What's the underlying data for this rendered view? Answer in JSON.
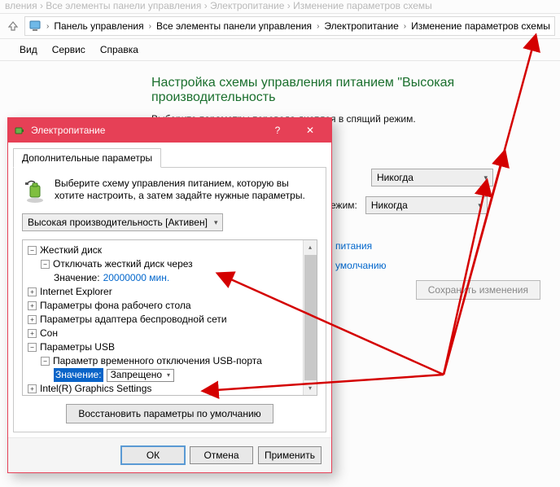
{
  "faded_title_suffix": "вления › Все элементы панели управления › Электропитание › Изменение параметров схемы",
  "breadcrumb": {
    "items": [
      "Панель управления",
      "Все элементы панели управления",
      "Электропитание",
      "Изменение параметров схемы"
    ]
  },
  "menu": {
    "items": [
      "Вид",
      "Сервис",
      "Справка"
    ]
  },
  "page": {
    "headline": "Настройка схемы управления питанием \"Высокая производительность",
    "subtext": "Выберите параметры перевода дисплея в спящий режим.",
    "row_suffix": "ежим:",
    "select1_value": "Никогда",
    "select2_value": "Никогда",
    "link1": "питания",
    "link2": "умолчанию",
    "save_button": "Сохранить изменения"
  },
  "dialog": {
    "title": "Электропитание",
    "tab_label": "Дополнительные параметры",
    "intro_text": "Выберите схему управления питанием, которую вы хотите настроить, а затем задайте нужные параметры.",
    "plan_select": "Высокая производительность [Активен]",
    "tree": {
      "hdd": "Жесткий диск",
      "hdd_off": "Отключать жесткий диск через",
      "hdd_val_label": "Значение:",
      "hdd_val": "20000000 мин.",
      "ie": "Internet Explorer",
      "bg": "Параметры фона рабочего стола",
      "wifi": "Параметры адаптера беспроводной сети",
      "sleep": "Сон",
      "usb": "Параметры USB",
      "usb_sel": "Параметр временного отключения USB-порта",
      "usb_val_label": "Значение:",
      "usb_val": "Запрещено",
      "intel": "Intel(R) Graphics Settings"
    },
    "restore_button": "Восстановить параметры по умолчанию",
    "ok": "ОК",
    "cancel": "Отмена",
    "apply": "Применить"
  }
}
